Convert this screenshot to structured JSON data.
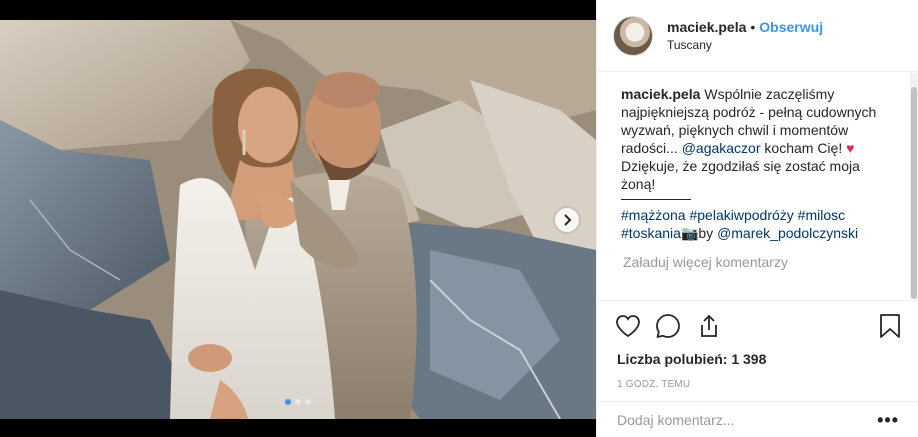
{
  "post": {
    "username": "maciek.pela",
    "separator": "•",
    "follow_label": "Obserwuj",
    "location": "Tuscany"
  },
  "caption": {
    "username": "maciek.pela",
    "text_1": "Wspólnie zaczęliśmy najpiękniejszą podróż - pełną cudownych wyzwań, pięknych chwil i momentów radości... ",
    "mention": "@agakaczor",
    "text_2": " kocham Cię! ",
    "heart": "♥",
    "text_3": " Dziękuje, że zgodziłaś się zostać moja żoną!"
  },
  "hashtags": {
    "tags": [
      "#mążżona",
      "#pelakiwpodróży",
      "#milosc",
      "#toskania"
    ],
    "camera": "📷",
    "by_text": "by ",
    "credit": "@marek_podolczynski"
  },
  "load_more_label": "Załaduj więcej komentarzy",
  "likes_label": "Liczba polubień: 1 398",
  "time_label": "1 GODZ. TEMU",
  "comment_placeholder": "Dodaj komentarz...",
  "more_label": "•••",
  "carousel": {
    "total": 3,
    "active_index": 0
  },
  "icons": {
    "like": "heart-icon",
    "comment": "comment-icon",
    "share": "share-icon",
    "save": "bookmark-icon",
    "next": "chevron-right-icon"
  },
  "colors": {
    "link": "#3897f0",
    "mention": "#003569",
    "muted": "#999999",
    "text": "#262626"
  }
}
